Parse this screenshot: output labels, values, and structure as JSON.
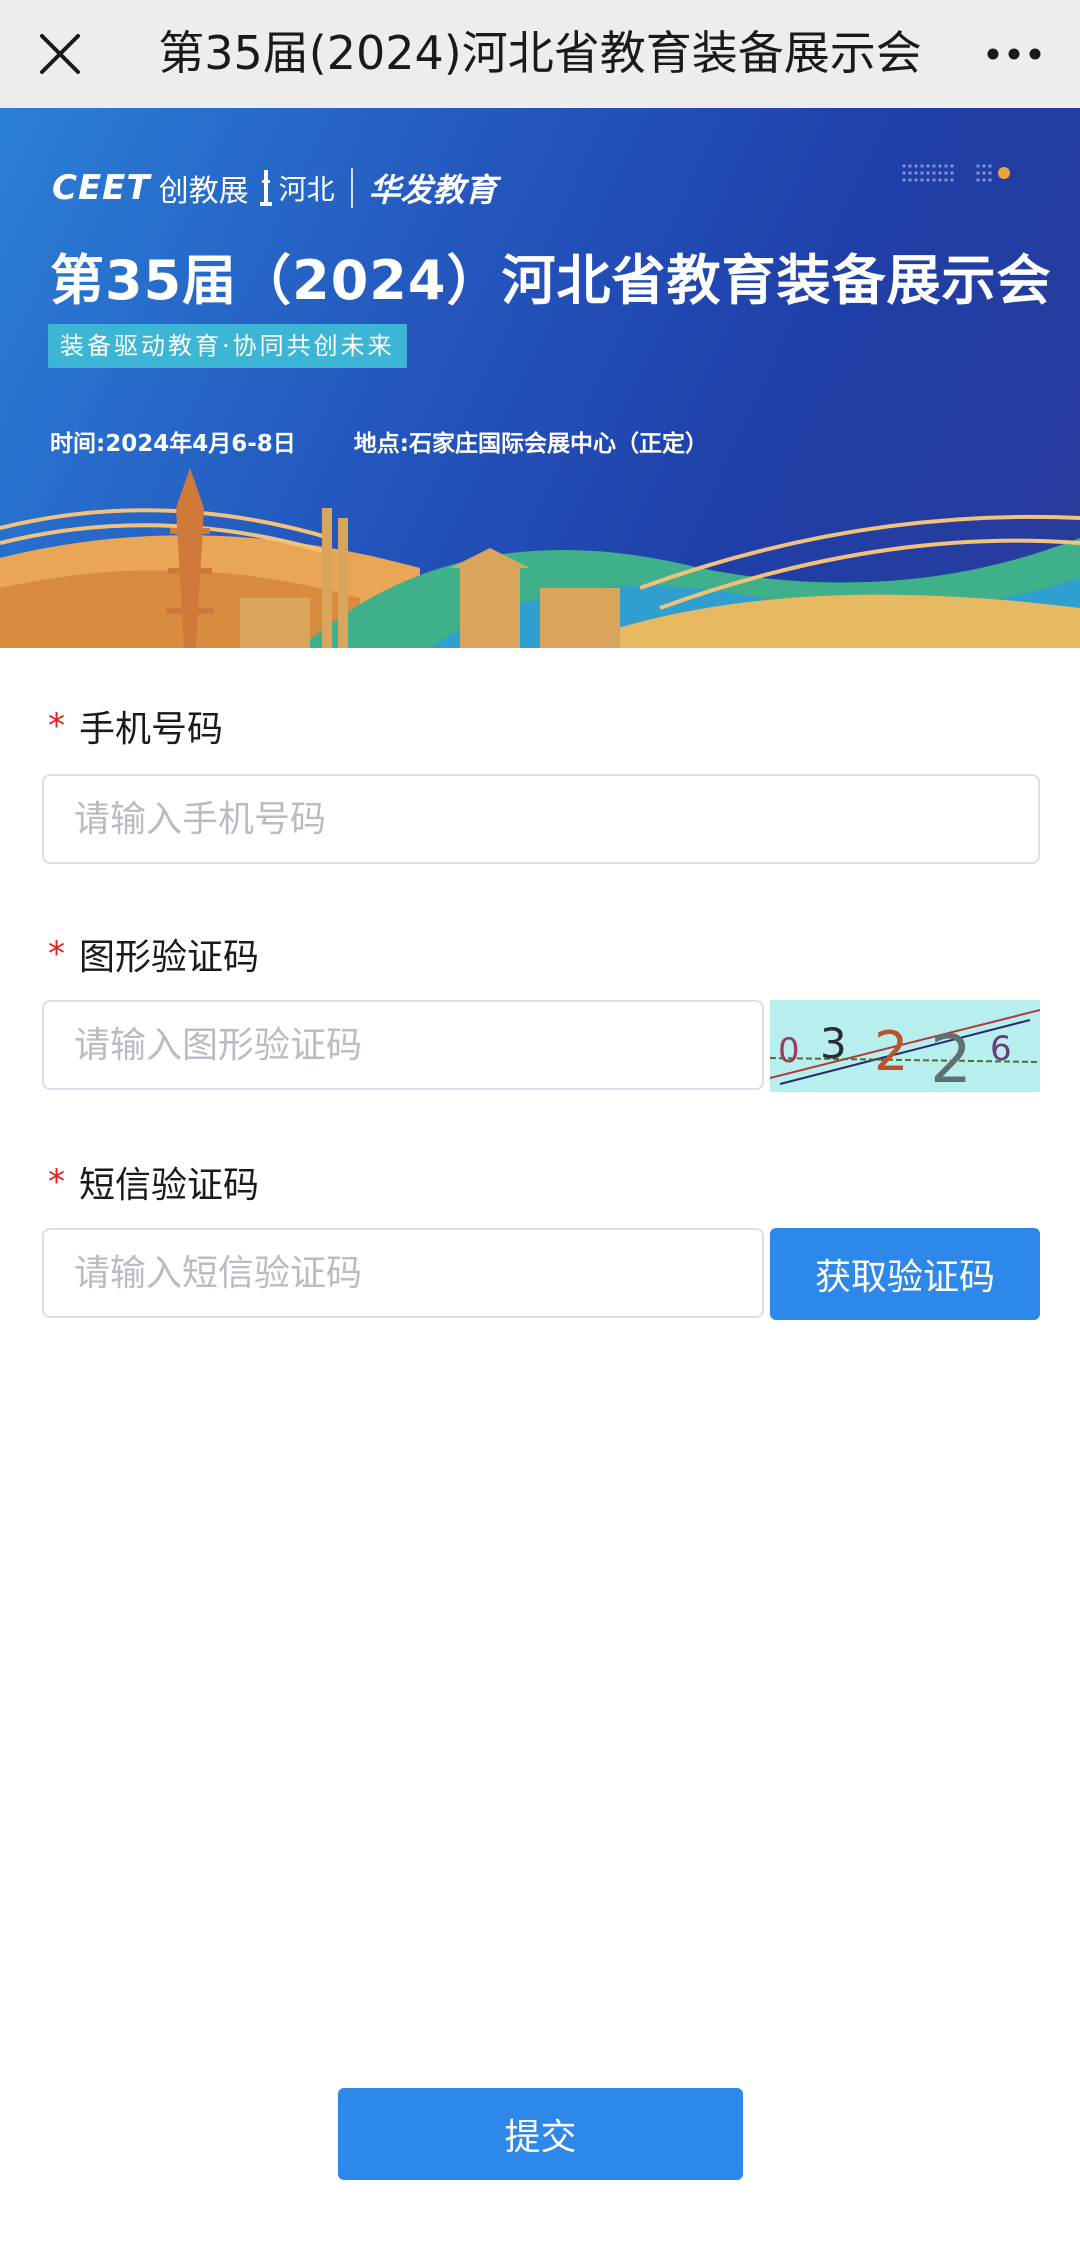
{
  "nav": {
    "title": "第35届(2024)河北省教育装备展示会",
    "close_icon": "close-icon",
    "more_icon": "more-horizontal-icon"
  },
  "banner": {
    "logo_ceet": "CEET",
    "logo_cn": "创教展",
    "logo_region": "河北",
    "logo_hf": "华发教育",
    "title": "第35届（2024）河北省教育装备展示会",
    "slogan": "装备驱动教育·协同共创未来",
    "time": "时间:2024年4月6-8日",
    "venue": "地点:石家庄国际会展中心（正定）"
  },
  "form": {
    "phone": {
      "label": "手机号码",
      "required_mark": "*",
      "placeholder": "请输入手机号码",
      "value": ""
    },
    "captcha": {
      "label": "图形验证码",
      "required_mark": "*",
      "placeholder": "请输入图形验证码",
      "value": "",
      "image_text": [
        "0",
        "3",
        "2",
        "2",
        "6"
      ]
    },
    "sms": {
      "label": "短信验证码",
      "required_mark": "*",
      "placeholder": "请输入短信验证码",
      "value": "",
      "button": "获取验证码"
    },
    "submit": "提交"
  },
  "colors": {
    "primary_button": "#2e88ea",
    "required": "#e02020",
    "nav_bg": "#ededed",
    "banner_blue": "#2456bd",
    "captcha_bg": "#b7eeee"
  }
}
